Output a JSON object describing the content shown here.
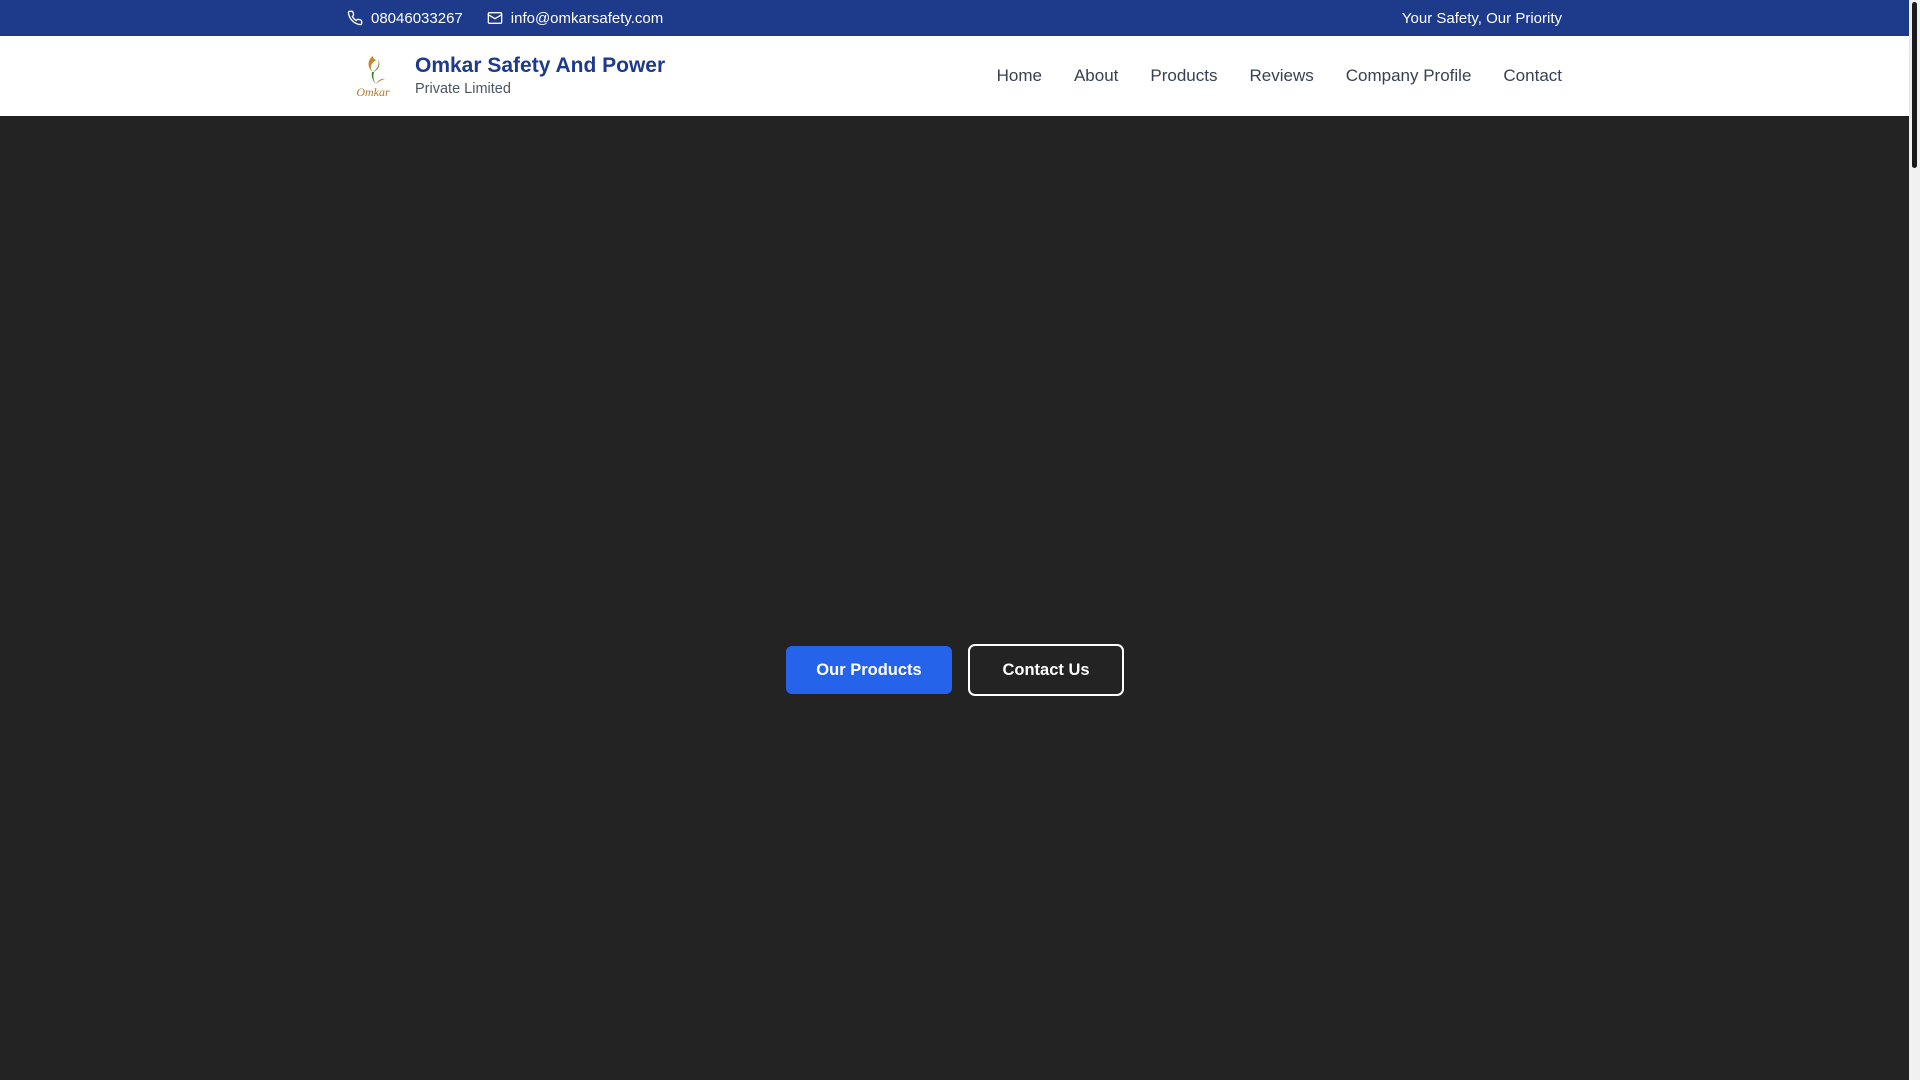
{
  "topbar": {
    "phone": "08046033267",
    "email": "info@omkarsafety.com",
    "tagline": "Your Safety, Our Priority",
    "phone_icon": "phone-icon",
    "email_icon": "mail-icon"
  },
  "brand": {
    "name": "Omkar Safety And Power",
    "subtitle": "Private Limited",
    "logo_text": "Omkar"
  },
  "nav": {
    "items": [
      {
        "label": "Home"
      },
      {
        "label": "About"
      },
      {
        "label": "Products"
      },
      {
        "label": "Reviews"
      },
      {
        "label": "Company Profile"
      },
      {
        "label": "Contact"
      }
    ]
  },
  "hero": {
    "primary_button": "Our Products",
    "secondary_button": "Contact Us"
  },
  "colors": {
    "topbar_bg": "#1e3a8a",
    "brand_name": "#1e3a8a",
    "hero_bg": "#232323",
    "primary_button": "#2563eb"
  }
}
